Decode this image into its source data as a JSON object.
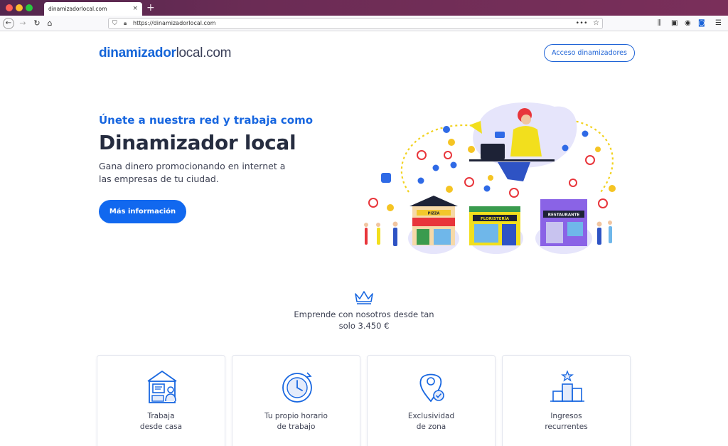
{
  "browser": {
    "tab_title": "dinamizadorlocal.com",
    "tab_close": "×",
    "new_tab": "+",
    "url": "https://dinamizadorlocal.com",
    "url_more": "•••"
  },
  "header": {
    "logo_bold": "dinamizador",
    "logo_light": "local.com",
    "access_button": "Acceso dinamizadores"
  },
  "hero": {
    "kicker": "Únete a nuestra red y trabaja como",
    "title": "Dinamizador local",
    "subtitle": "Gana dinero promocionando en internet a las empresas de tu ciudad.",
    "cta": "Más información",
    "shop_signs": {
      "pizza": "PIZZA",
      "florist": "FLORISTERÍA",
      "restaurant": "RESTAURANTE"
    }
  },
  "promo": {
    "text": "Emprende con nosotros desde tan solo 3.450 €"
  },
  "features": [
    {
      "label": "Trabaja\ndesde casa",
      "icon": "home-office-icon"
    },
    {
      "label": "Tu propio horario\nde trabajo",
      "icon": "clock-icon"
    },
    {
      "label": "Exclusividad\nde zona",
      "icon": "location-pin-icon"
    },
    {
      "label": "Ingresos\nrecurrentes",
      "icon": "podium-icon"
    }
  ],
  "colors": {
    "brand_blue": "#1766e0",
    "button_blue": "#1168ef",
    "dark_text": "#262d40",
    "tab_bar": "#6b2c55"
  }
}
